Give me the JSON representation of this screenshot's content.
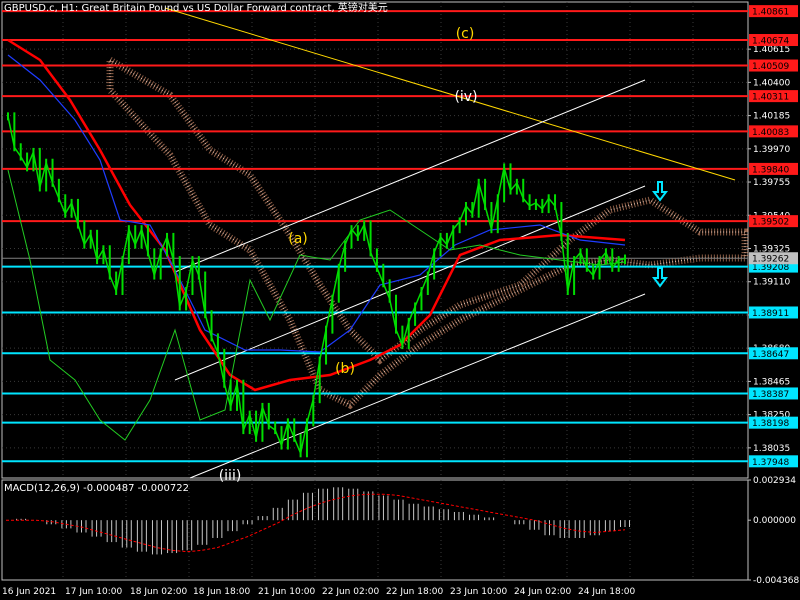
{
  "header": {
    "title": "GBPUSD.c, H1:  Great Britain Pound vs US Dollar Forward contract, 英镑对美元"
  },
  "colors": {
    "background": "#000000",
    "grid": "#3a3a3a",
    "price_line_support": "#00e5ff",
    "price_line_resistance": "#ff1a1a",
    "candle_green": "#00dd00",
    "ma_red": "#ff0000",
    "ma_blue": "#1e3cff",
    "cloud": "#ffaa80",
    "trendline_yellow": "#ffd700",
    "channel_white": "#ffffff",
    "wave_yellow": "#ffd700",
    "wave_white": "#ffffff",
    "macd_hist": "#c8c8c8",
    "macd_signal": "#ff0000"
  },
  "chart_data": [
    {
      "type": "line",
      "title": "",
      "ylim": [
        1.3784,
        1.4092
      ],
      "y_ticks": [
        "1.40615",
        "1.40400",
        "1.40185",
        "1.39970",
        "1.39755",
        "1.39540",
        "1.39325",
        "1.39110",
        "1.38895",
        "1.38680",
        "1.38465",
        "1.38250",
        "1.38035"
      ],
      "x_labels": [
        "16 Jun 2021",
        "17 Jun 10:00",
        "18 Jun 02:00",
        "18 Jun 18:00",
        "21 Jun 10:00",
        "22 Jun 02:00",
        "22 Jun 18:00",
        "23 Jun 10:00",
        "24 Jun 02:00",
        "24 Jun 18:00"
      ],
      "current_price": "1.39262",
      "resistance_levels": [
        "1.40861",
        "1.40674",
        "1.40509",
        "1.40311",
        "1.40083",
        "1.39840",
        "1.39502"
      ],
      "support_levels": [
        "1.39208",
        "1.38911",
        "1.38647",
        "1.38387",
        "1.38198",
        "1.37948"
      ],
      "wave_labels": [
        "(c)",
        "(iv)",
        "(a)",
        "(b)",
        "(iii)"
      ],
      "series": [
        {
          "name": "",
          "values": [
            1.4018,
            1.3998,
            1.3992,
            1.3985,
            1.3995,
            1.3972,
            1.3988,
            1.3975,
            1.3965,
            1.3955,
            1.3962,
            1.3948,
            1.3935,
            1.3942,
            1.3925,
            1.3932,
            1.3915,
            1.3905,
            1.3925,
            1.3945,
            1.3935,
            1.3945,
            1.393,
            1.3915,
            1.393,
            1.394,
            1.3925,
            1.3895,
            1.3905,
            1.3925,
            1.3915,
            1.389,
            1.3875,
            1.3865,
            1.3845,
            1.383,
            1.3845,
            1.3815,
            1.3825,
            1.381,
            1.383,
            1.3818,
            1.3815,
            1.3805,
            1.382,
            1.381,
            1.38,
            1.382,
            1.3835,
            1.386,
            1.388,
            1.39,
            1.392,
            1.3935,
            1.3945,
            1.394,
            1.3948,
            1.393,
            1.392,
            1.391,
            1.39,
            1.388,
            1.387,
            1.3885,
            1.3895,
            1.3905,
            1.3915,
            1.393,
            1.394,
            1.3935,
            1.3945,
            1.395,
            1.396,
            1.3955,
            1.3975,
            1.396,
            1.3945,
            1.3965,
            1.3985,
            1.397,
            1.3975,
            1.3965,
            1.396,
            1.3962,
            1.3958,
            1.3965,
            1.396,
            1.394,
            1.3905,
            1.3925,
            1.393,
            1.392,
            1.3915,
            1.3925,
            1.393,
            1.392,
            1.3925,
            1.3926
          ]
        }
      ]
    },
    {
      "type": "bar",
      "title": "",
      "indicator": "MACD(12,26,9) -0.000487 -0.000722",
      "ylim": [
        -0.004368,
        0.002934
      ],
      "y_ticks": [
        "0.002934",
        "0.000000",
        "-0.004368"
      ],
      "series": [
        {
          "name": "",
          "values": [
            0.0,
            0.0001,
            0.0,
            -0.0003,
            -0.0006,
            -0.0009,
            -0.0012,
            -0.0016,
            -0.002,
            -0.0023,
            -0.0025,
            -0.0024,
            -0.0022,
            -0.0018,
            -0.0013,
            -0.0008,
            -0.0003,
            0.0003,
            0.0009,
            0.0015,
            0.002,
            0.0023,
            0.0024,
            0.0023,
            0.0021,
            0.0018,
            0.0015,
            0.0012,
            0.001,
            0.0008,
            0.0006,
            0.0004,
            0.0002,
            0.0,
            -0.0003,
            -0.0007,
            -0.0011,
            -0.0013,
            -0.0013,
            -0.0011,
            -0.0008,
            -0.0005
          ]
        },
        {
          "name": "",
          "values": [
            0.0,
            0.0,
            0.0,
            -0.0001,
            -0.0003,
            -0.0005,
            -0.0008,
            -0.0011,
            -0.0014,
            -0.0017,
            -0.002,
            -0.0022,
            -0.0023,
            -0.0022,
            -0.002,
            -0.0016,
            -0.0012,
            -0.0007,
            -0.0002,
            0.0004,
            0.0009,
            0.0013,
            0.0016,
            0.0018,
            0.0019,
            0.0019,
            0.0018,
            0.0016,
            0.0014,
            0.0012,
            0.001,
            0.0008,
            0.0006,
            0.0004,
            0.0002,
            0.0,
            -0.0003,
            -0.0006,
            -0.0008,
            -0.0009,
            -0.0008,
            -0.0007
          ]
        }
      ]
    }
  ]
}
